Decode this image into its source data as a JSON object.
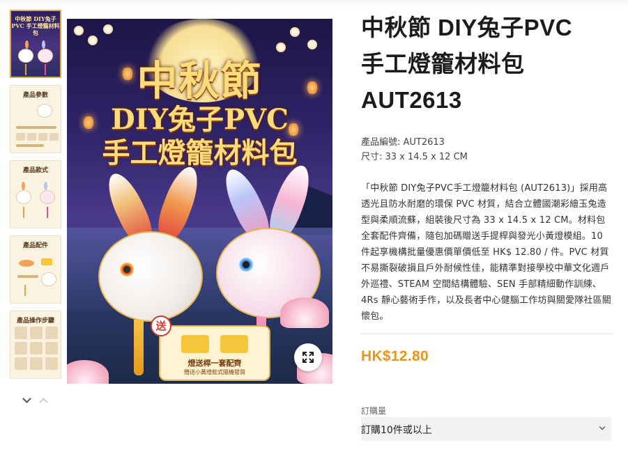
{
  "gallery": {
    "thumbnails": [
      {
        "title": "中秋節 DIY兔子PVC 手工燈籠材料包"
      },
      {
        "title": "產品參數"
      },
      {
        "title": "產品款式"
      },
      {
        "title": "產品配件"
      },
      {
        "title": "產品操作步驟"
      }
    ],
    "main_image": {
      "title_line1": "中秋節",
      "title_line2": "DIY兔子PVC",
      "title_line3": "手工燈籠材料包",
      "gift_badge": "送",
      "gift_line1": "燈送桿一套配齊",
      "gift_line2": "贈送小黃燈款式隨機發貨"
    },
    "icons": {
      "zoom": "expand-icon",
      "prev": "chevron-down-icon",
      "next": "chevron-up-icon"
    }
  },
  "product": {
    "title_line1": "中秋節 DIY兔子PVC",
    "title_line2": "手工燈籠材料包",
    "title_line3": "AUT2613",
    "sku": "產品編號: AUT2613",
    "size": "尺寸: 33 x 14.5 x 12 CM",
    "description": "「中秋節 DIY兔子PVC手工燈籠材料包 (AUT2613)」採用高透光且防水耐磨的環保 PVC 材質，結合立體國潮彩繪玉兔造型與柔順流蘇，組裝後尺寸為 33 x 14.5 x 12 CM。材料包全套配件齊備，隨包加碼贈送手提桿與發光小黃燈模組。10 件起享機構批量優惠價單價低至 HK$ 12.80 / 件。PVC 材質不易撕裂破損且戶外耐候性佳，能精準對接學校中華文化週戶外巡禮、STEAM 空間結構體驗、SEN 手部精細動作訓練、4Rs 靜心藝術手作，以及長者中心健腦工作坊與關愛隊社區關懷包。",
    "price": "HK$12.80",
    "quantity_label": "訂購量",
    "quantity_selected": "訂購10件或以上"
  },
  "colors": {
    "accent": "#e99518",
    "active_thumb": "#e7a33d"
  }
}
